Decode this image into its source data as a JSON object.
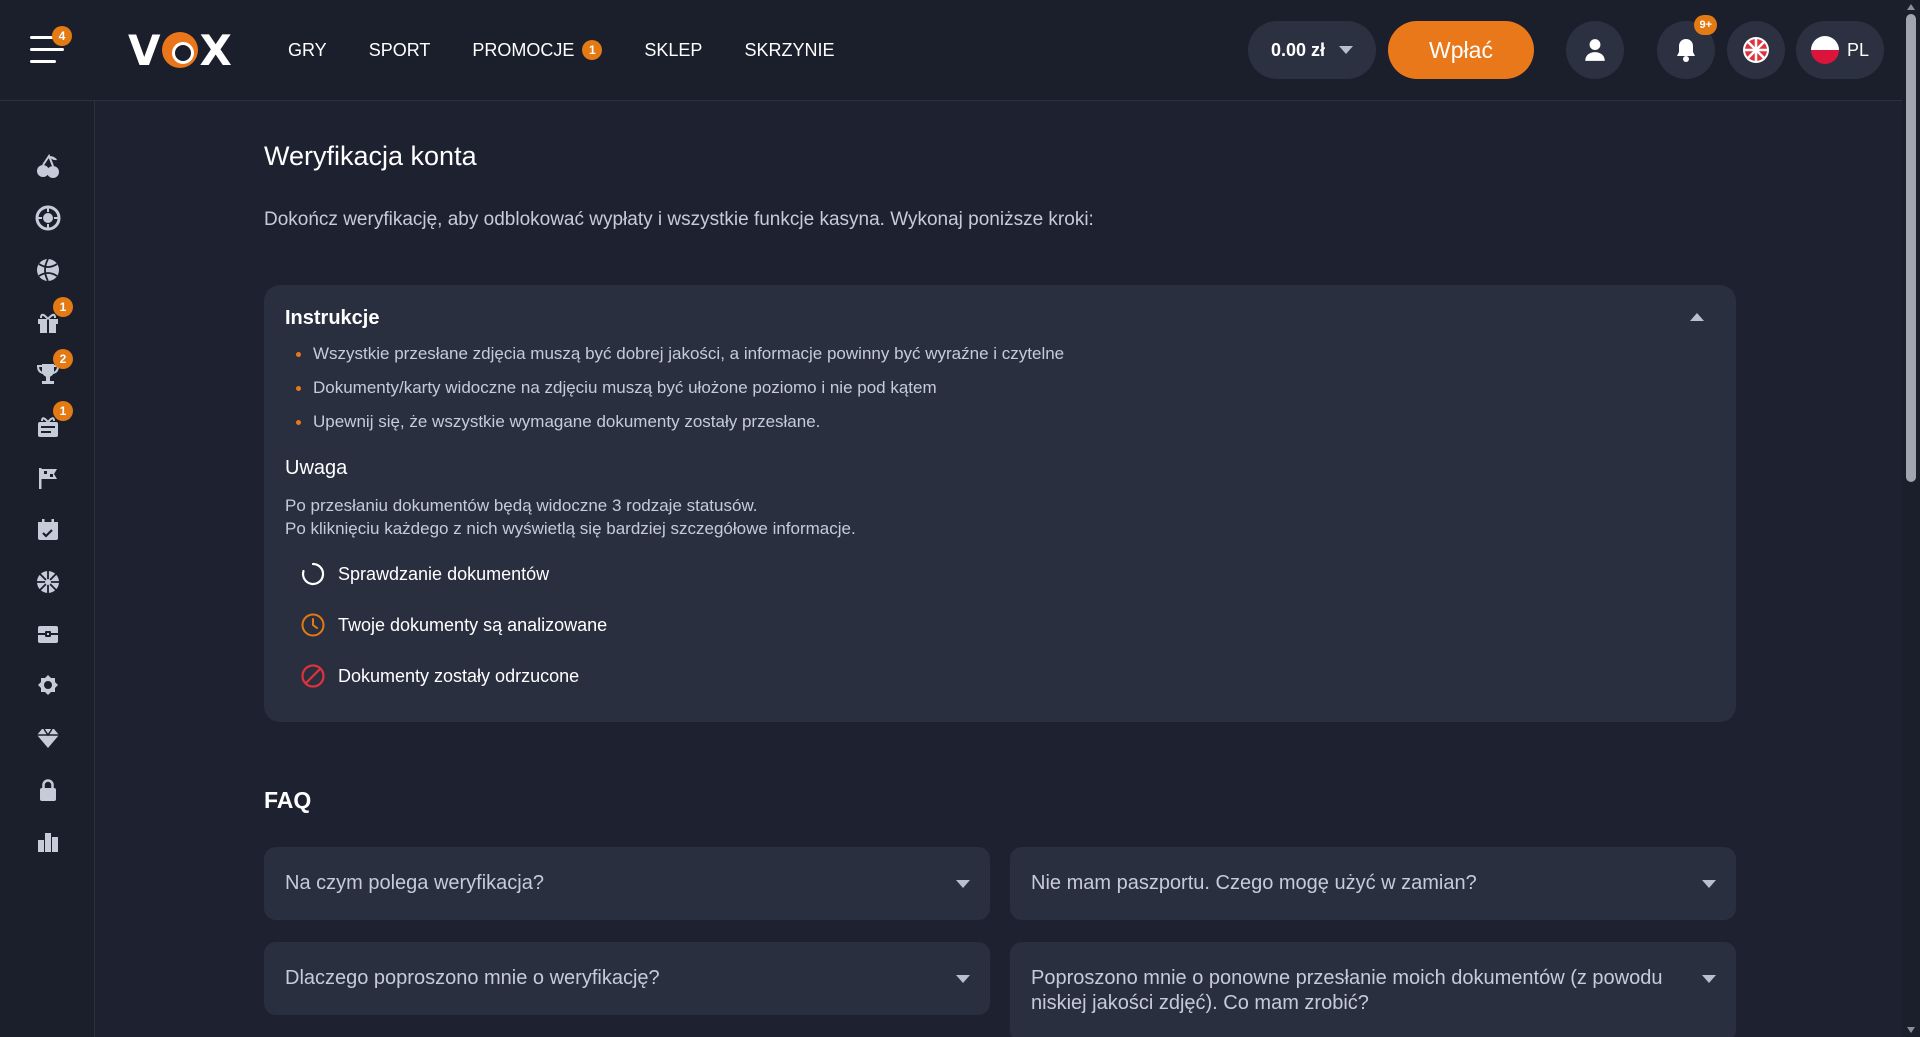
{
  "header": {
    "menu_badge": "4",
    "logo": "VOX",
    "nav": [
      {
        "label": "GRY"
      },
      {
        "label": "SPORT"
      },
      {
        "label": "PROMOCJE",
        "badge": "1"
      },
      {
        "label": "SKLEP"
      },
      {
        "label": "SKRZYNIE"
      }
    ],
    "balance": "0.00 zł",
    "deposit_label": "Wpłać",
    "notifications_badge": "9+",
    "language": "PL"
  },
  "sidebar": {
    "items": [
      {
        "icon": "cherries-icon"
      },
      {
        "icon": "roulette-icon"
      },
      {
        "icon": "sport-ball-icon"
      },
      {
        "icon": "gift-icon",
        "badge": "1"
      },
      {
        "icon": "trophy-icon",
        "badge": "2"
      },
      {
        "icon": "bonus-ticket-icon",
        "badge": "1"
      },
      {
        "icon": "flag-icon"
      },
      {
        "icon": "calendar-icon"
      },
      {
        "icon": "wheel-icon"
      },
      {
        "icon": "chest-icon"
      },
      {
        "icon": "badge-icon"
      },
      {
        "icon": "diamond-icon"
      },
      {
        "icon": "lock-icon"
      },
      {
        "icon": "leaderboard-icon"
      }
    ]
  },
  "page": {
    "title": "Weryfikacja konta",
    "description": "Dokończ weryfikację, aby odblokować wypłaty i wszystkie funkcje kasyna. Wykonaj poniższe kroki:"
  },
  "instructions": {
    "title": "Instrukcje",
    "rules": [
      "Wszystkie przesłane zdjęcia muszą być dobrej jakości, a informacje powinny być wyraźne i czytelne",
      "Dokumenty/karty widoczne na zdjęciu muszą być ułożone poziomo i nie pod kątem",
      "Upewnij się, że wszystkie wymagane dokumenty zostały przesłane."
    ],
    "note_title": "Uwaga",
    "note_line1": "Po przesłaniu dokumentów będą widoczne 3 rodzaje statusów.",
    "note_line2": "Po kliknięciu każdego z nich wyświetlą się bardziej szczegółowe informacje.",
    "statuses": [
      {
        "label": "Sprawdzanie dokumentów",
        "icon": "spinner-icon",
        "color": "#ffffff"
      },
      {
        "label": "Twoje dokumenty są analizowane",
        "icon": "clock-icon",
        "color": "#e37a14"
      },
      {
        "label": "Dokumenty zostały odrzucone",
        "icon": "rejected-icon",
        "color": "#e0323c"
      }
    ]
  },
  "faq": {
    "title": "FAQ",
    "items": [
      {
        "question": "Na czym polega weryfikacja?"
      },
      {
        "question": "Nie mam paszportu. Czego mogę użyć w zamian?"
      },
      {
        "question": "Dlaczego poproszono mnie o weryfikację?"
      },
      {
        "question": "Poproszono mnie o ponowne przesłanie moich dokumentów (z powodu niskiej jakości zdjęć). Co mam zrobić?"
      }
    ]
  },
  "colors": {
    "accent": "#e9781b",
    "background": "#1e2230",
    "card": "#2a2f40"
  }
}
